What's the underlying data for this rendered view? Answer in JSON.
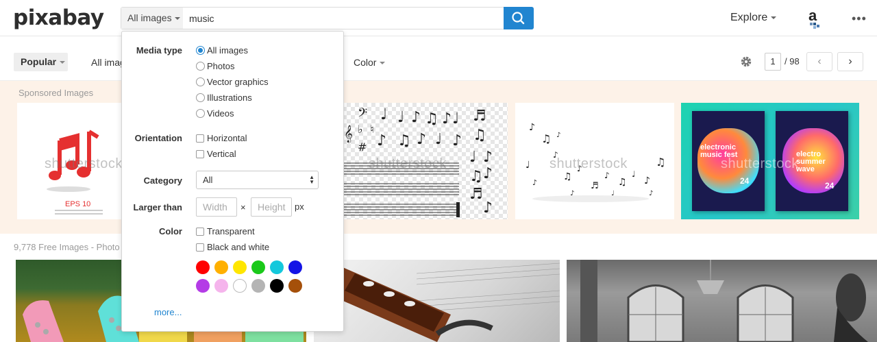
{
  "header": {
    "logo": "pixabay",
    "search": {
      "type_label": "All images",
      "query": "music"
    },
    "explore_label": "Explore",
    "more_icon": "more-horizontal-icon"
  },
  "filters": {
    "popular_label": "Popular",
    "all_images_label": "All imag",
    "color_label": "Color",
    "page_current": "1",
    "page_total": "/ 98"
  },
  "sponsored": {
    "label": "Sponsored Images",
    "watermark": "shutterstock",
    "eps_label": "EPS 10",
    "poster_left_title": "electronic\nmusic fest",
    "poster_right_title": "electro\nsummer\nwave",
    "poster_left_date": "24",
    "poster_right_date": "24"
  },
  "results": {
    "count_label": "9,778 Free Images - Photo"
  },
  "dropdown": {
    "media_type_label": "Media type",
    "media_options": [
      "All images",
      "Photos",
      "Vector graphics",
      "Illustrations",
      "Videos"
    ],
    "media_selected": "All images",
    "orientation_label": "Orientation",
    "orientation_options": [
      "Horizontal",
      "Vertical"
    ],
    "category_label": "Category",
    "category_value": "All",
    "larger_than_label": "Larger than",
    "width_placeholder": "Width",
    "height_placeholder": "Height",
    "times_symbol": "×",
    "unit": "px",
    "color_label": "Color",
    "color_options": [
      "Transparent",
      "Black and white"
    ],
    "swatches": [
      "#ff0000",
      "#ffb000",
      "#ffe600",
      "#1ac91a",
      "#14c8dc",
      "#1414e6",
      "#b43ce6",
      "#f5b4ec",
      "#ffffff",
      "#b4b4b4",
      "#000000",
      "#a5500a"
    ],
    "more_label": "more..."
  }
}
